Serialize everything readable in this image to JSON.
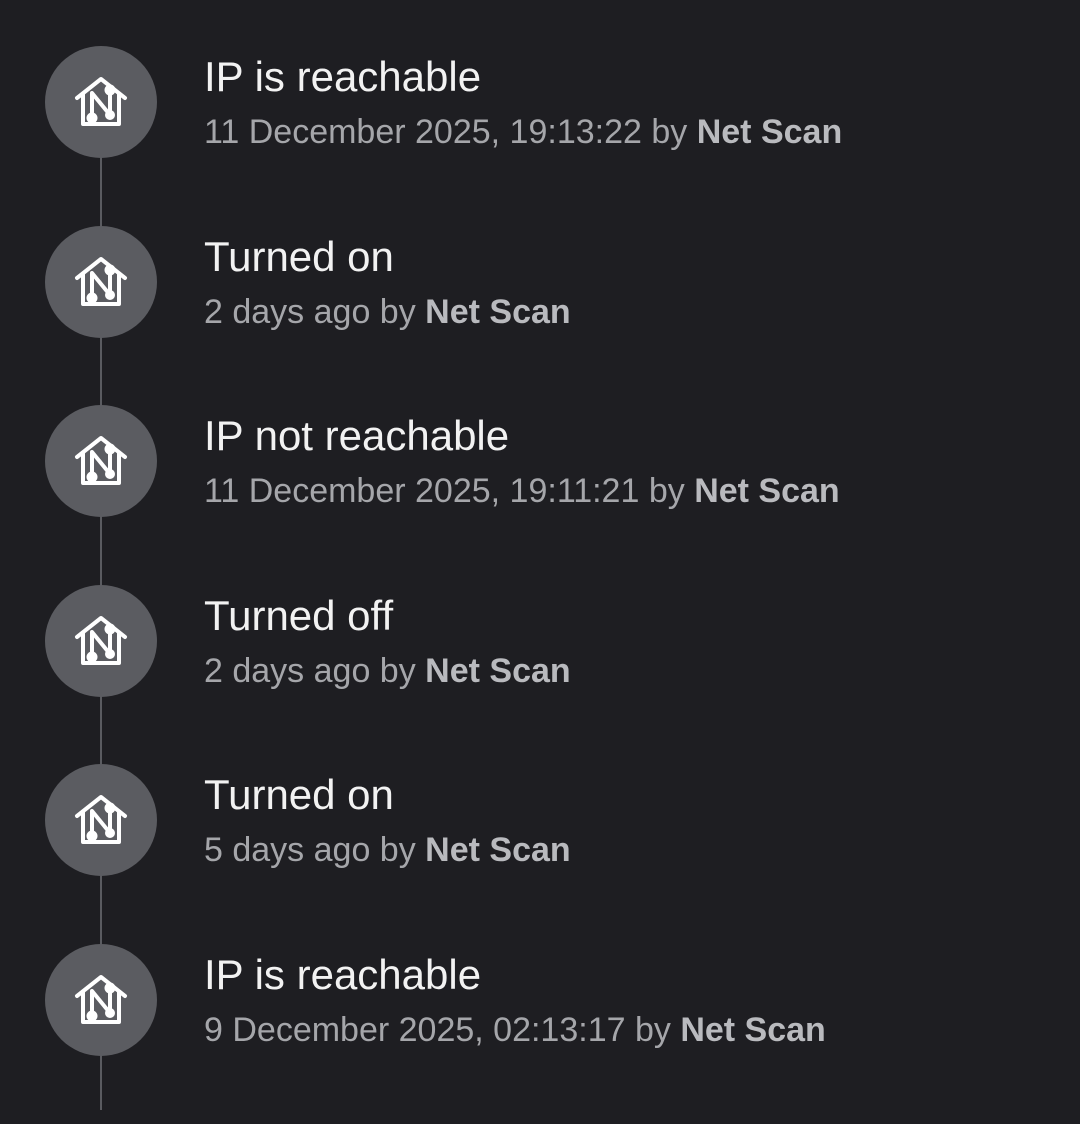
{
  "logbook": {
    "entries": [
      {
        "title": "IP is reachable",
        "time": "11 December 2025, 19:13:22",
        "by": " by ",
        "author": "Net Scan",
        "icon": "net-scan-house-icon"
      },
      {
        "title": "Turned on",
        "time": "2 days ago",
        "by": " by ",
        "author": "Net Scan",
        "icon": "net-scan-house-icon"
      },
      {
        "title": "IP not reachable",
        "time": "11 December 2025, 19:11:21",
        "by": " by ",
        "author": "Net Scan",
        "icon": "net-scan-house-icon"
      },
      {
        "title": "Turned off",
        "time": "2 days ago",
        "by": " by ",
        "author": "Net Scan",
        "icon": "net-scan-house-icon"
      },
      {
        "title": "Turned on",
        "time": "5 days ago",
        "by": " by ",
        "author": "Net Scan",
        "icon": "net-scan-house-icon"
      },
      {
        "title": "IP is reachable",
        "time": "9 December 2025, 02:13:17",
        "by": " by ",
        "author": "Net Scan",
        "icon": "net-scan-house-icon"
      }
    ]
  },
  "colors": {
    "background": "#1e1e22",
    "avatar": "#5b5c61",
    "line": "#5a5b60",
    "title": "#f2f2f2",
    "secondary": "#a5a6aa"
  }
}
